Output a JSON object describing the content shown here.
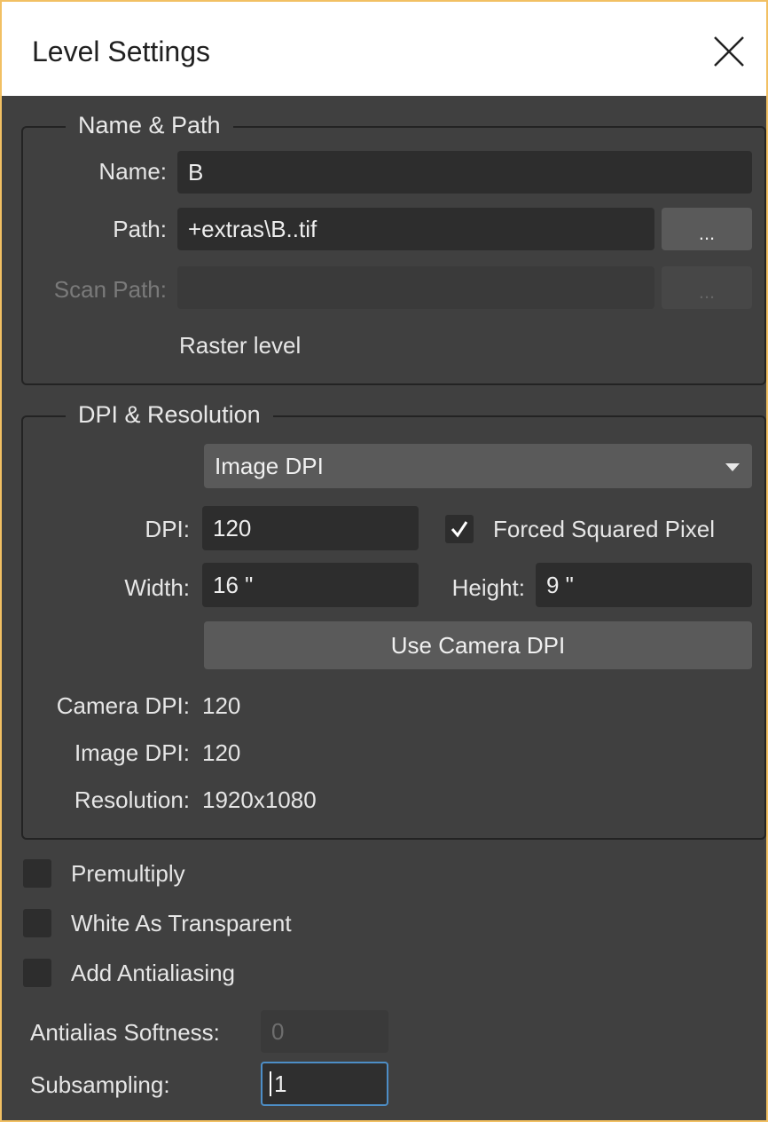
{
  "window": {
    "title": "Level Settings",
    "close_icon": "close-icon"
  },
  "name_path": {
    "title": "Name & Path",
    "name_label": "Name:",
    "name_value": "B",
    "path_label": "Path:",
    "path_value": "+extras\\B..tif",
    "browse_label": "...",
    "scan_path_label": "Scan Path:",
    "scan_path_value": "",
    "scan_browse_label": "...",
    "level_type": "Raster level"
  },
  "dpi_resolution": {
    "title": "DPI & Resolution",
    "dpi_mode": "Image DPI",
    "dpi_label": "DPI:",
    "dpi_value": "120",
    "forced_squared_label": "Forced Squared Pixel",
    "forced_squared_checked": true,
    "width_label": "Width:",
    "width_value": "16 \"",
    "height_label": "Height:",
    "height_value": "9 \"",
    "use_camera_dpi_label": "Use Camera DPI",
    "camera_dpi_label": "Camera DPI:",
    "camera_dpi_value": "120",
    "image_dpi_label": "Image DPI:",
    "image_dpi_value": "120",
    "resolution_label": "Resolution:",
    "resolution_value": "1920x1080"
  },
  "options": {
    "premultiply_label": "Premultiply",
    "premultiply_checked": false,
    "white_transparent_label": "White As Transparent",
    "white_transparent_checked": false,
    "add_antialiasing_label": "Add Antialiasing",
    "add_antialiasing_checked": false,
    "antialias_softness_label": "Antialias Softness:",
    "antialias_softness_value": "0",
    "subsampling_label": "Subsampling:",
    "subsampling_value": "1"
  },
  "colors": {
    "accent_border": "#f2c063",
    "focus": "#4d8ec7"
  }
}
